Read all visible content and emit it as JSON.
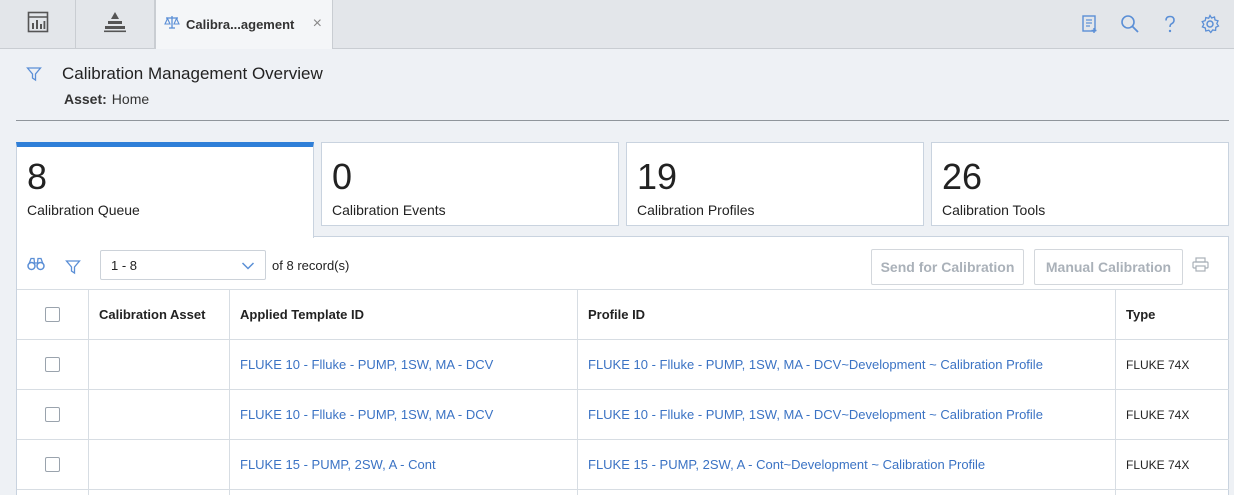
{
  "topbar": {
    "active_tab_label": "Calibra...agement",
    "close_glyph": "×",
    "icons": [
      "dashboard-icon",
      "hierarchy-icon",
      "scales-icon",
      "report-icon",
      "search-icon",
      "help-icon",
      "settings-icon"
    ]
  },
  "header": {
    "title": "Calibration Management Overview",
    "asset_label": "Asset:",
    "asset_value": "Home"
  },
  "cards": [
    {
      "count": "8",
      "label": "Calibration Queue"
    },
    {
      "count": "0",
      "label": "Calibration Events"
    },
    {
      "count": "19",
      "label": "Calibration Profiles"
    },
    {
      "count": "26",
      "label": "Calibration Tools"
    }
  ],
  "toolbar": {
    "range": "1 - 8",
    "of_label": "of",
    "total": "8",
    "records_label": "record(s)",
    "send_button": "Send for Calibration",
    "manual_button": "Manual Calibration"
  },
  "table": {
    "headers": [
      "Calibration Asset",
      "Applied Template ID",
      "Profile ID",
      "Type"
    ],
    "rows": [
      {
        "asset": "",
        "template": "FLUKE 10 - Flluke - PUMP, 1SW, MA - DCV",
        "profile": "FLUKE 10 - Flluke - PUMP, 1SW, MA - DCV~Development ~ Calibration Profile",
        "type": "FLUKE 74X"
      },
      {
        "asset": "",
        "template": "FLUKE 10 - Flluke - PUMP, 1SW, MA - DCV",
        "profile": "FLUKE 10 - Flluke - PUMP, 1SW, MA - DCV~Development ~ Calibration Profile",
        "type": "FLUKE 74X"
      },
      {
        "asset": "",
        "template": "FLUKE 15 - PUMP, 2SW, A - Cont",
        "profile": "FLUKE 15 - PUMP, 2SW, A - Cont~Development ~ Calibration Profile",
        "type": "FLUKE 74X"
      }
    ]
  },
  "colors": {
    "accent": "#2f7fd8",
    "link": "#3b73c4",
    "icon": "#5b8fd6"
  }
}
